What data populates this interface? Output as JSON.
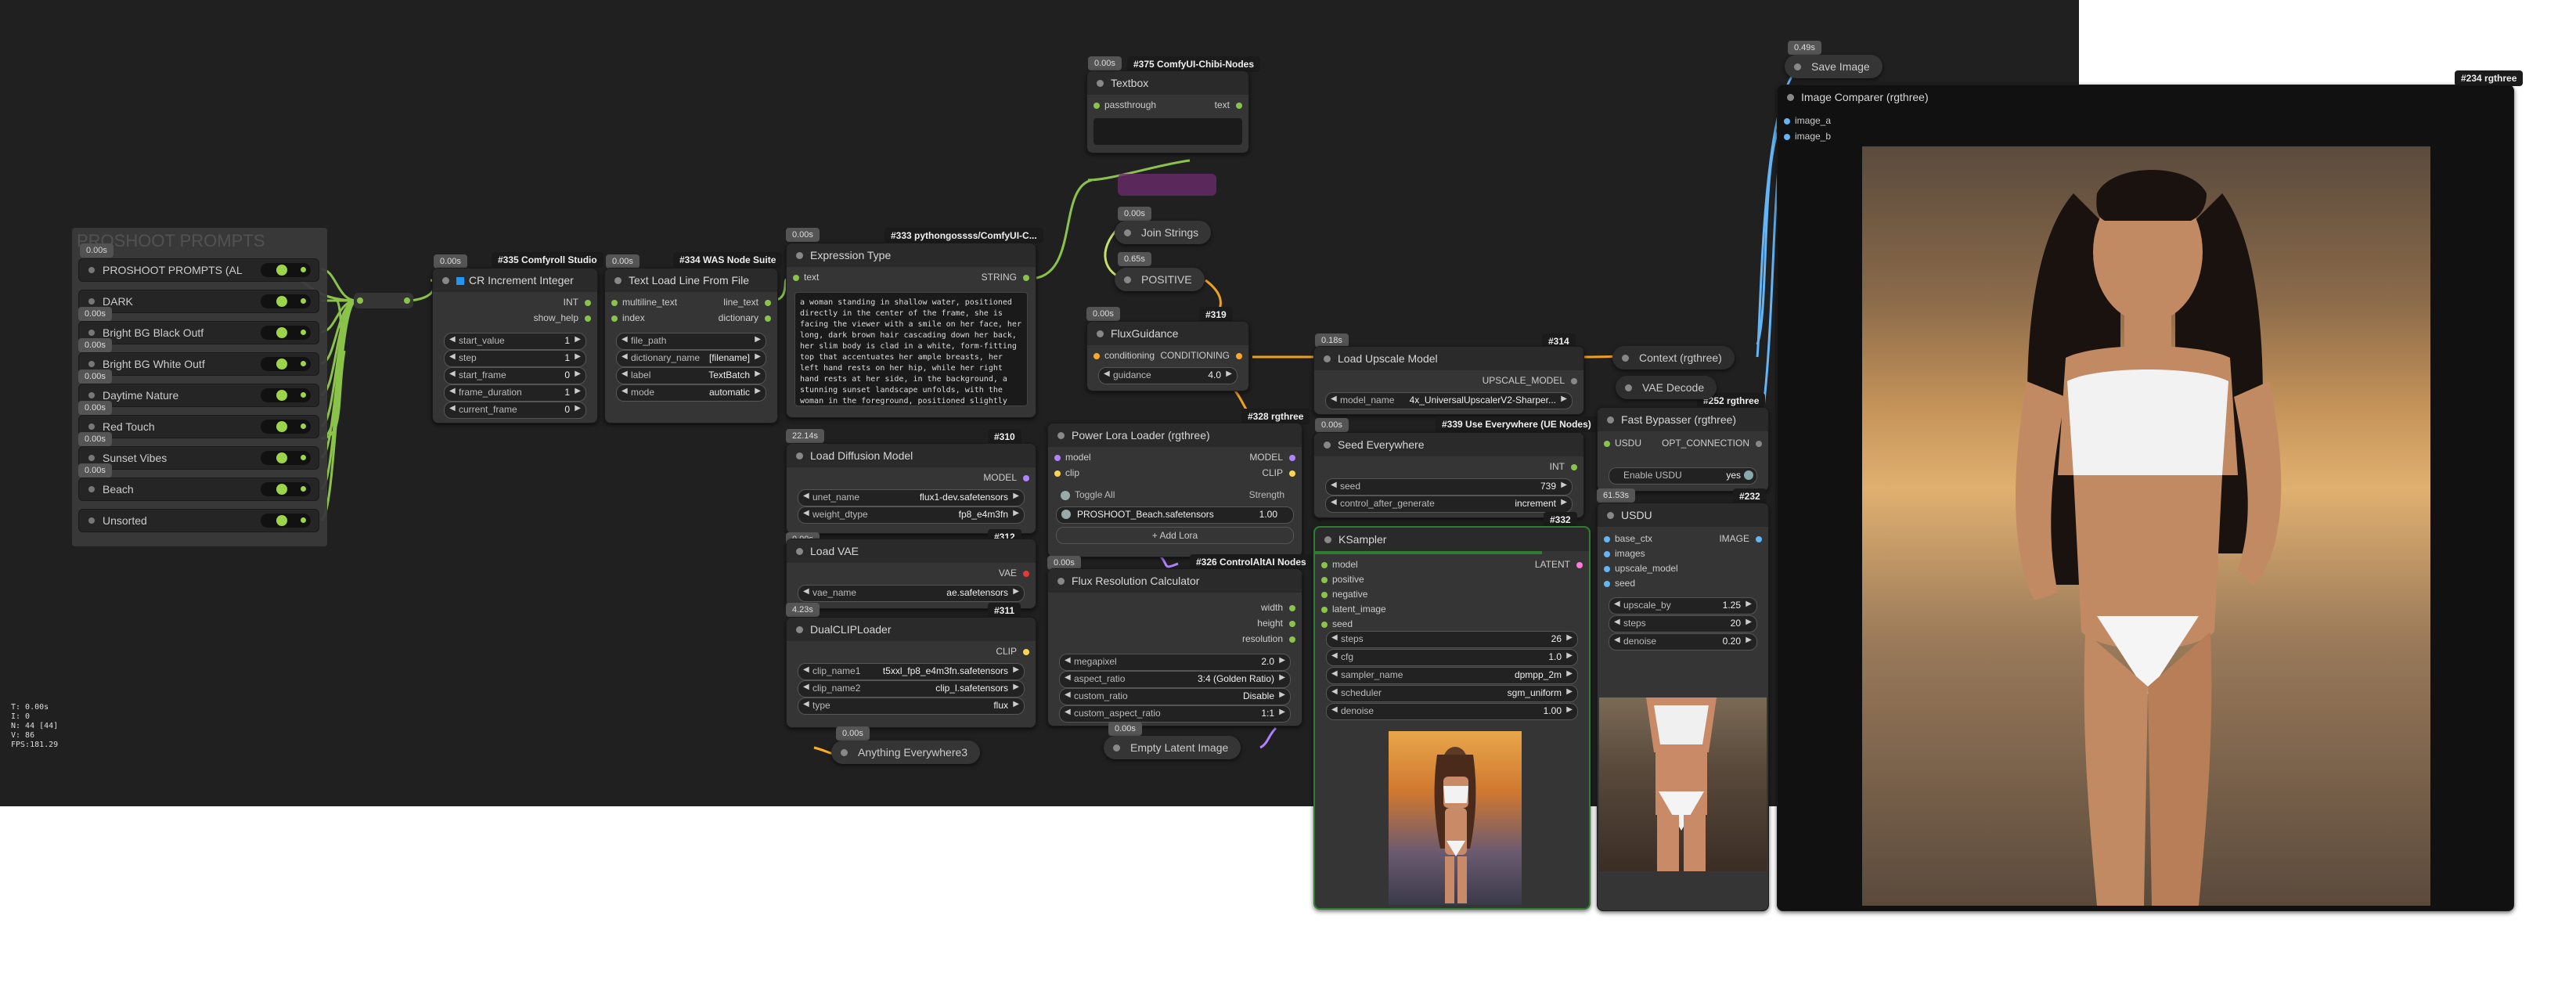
{
  "canvas_info": [
    "T: 0.00s",
    "I: 0",
    "N: 44 [44]",
    "V: 86",
    "FPS:181.29"
  ],
  "group": {
    "title": "PROSHOOT PROMPTS",
    "badge_timing": "0.00s",
    "toggles": [
      {
        "label": "PROSHOOT PROMPTS (AL"
      },
      {
        "label": "DARK"
      },
      {
        "label": "Bright BG Black Outf"
      },
      {
        "label": "Bright BG White Outf"
      },
      {
        "label": "Daytime Nature"
      },
      {
        "label": "Red Touch"
      },
      {
        "label": "Sunset Vibes"
      },
      {
        "label": "Beach"
      },
      {
        "label": "Unsorted"
      }
    ],
    "small_badges": [
      "0.00s",
      "0.00s",
      "0.00s",
      "0.00s",
      "0.00s",
      "0.00s"
    ]
  },
  "nodes": {
    "cr_increment": {
      "timing": "0.00s",
      "id": "#335 Comfyroll Studio",
      "title": "CR Increment Integer",
      "outputs": [
        "INT",
        "show_help"
      ],
      "widgets": [
        {
          "label": "start_value",
          "value": "1"
        },
        {
          "label": "step",
          "value": "1"
        },
        {
          "label": "start_frame",
          "value": "0"
        },
        {
          "label": "frame_duration",
          "value": "1"
        },
        {
          "label": "current_frame",
          "value": "0"
        }
      ]
    },
    "text_load": {
      "timing": "0.00s",
      "id": "#334 WAS Node Suite",
      "title": "Text Load Line From File",
      "inputs": [
        "multiline_text",
        "index"
      ],
      "outputs": [
        "line_text",
        "dictionary"
      ],
      "widgets": [
        {
          "label": "file_path",
          "value": ""
        },
        {
          "label": "dictionary_name",
          "value": "[filename]"
        },
        {
          "label": "label",
          "value": "TextBatch"
        },
        {
          "label": "mode",
          "value": "automatic"
        }
      ]
    },
    "expression_type": {
      "timing": "0.00s",
      "id": "#333 pythongossss/ComfyUI-C...",
      "title": "Expression Type",
      "input": "text",
      "output": "STRING",
      "text": "a woman standing in shallow water, positioned directly in the center of the frame, she is facing the viewer with a smile on her face, her long, dark brown hair cascading down her back, her slim body is clad in a white, form-fitting top that accentuates her ample breasts, her left hand rests on her hip, while her right hand rests at her side, in the background, a stunning sunset landscape unfolds, with the woman in the foreground, positioned slightly off-center to the right, the overall effect is one of serenity and tranquility"
    },
    "load_diffusion": {
      "timing": "22.14s",
      "id": "#310",
      "title": "Load Diffusion Model",
      "output": "MODEL",
      "widgets": [
        {
          "label": "unet_name",
          "value": "flux1-dev.safetensors"
        },
        {
          "label": "weight_dtype",
          "value": "fp8_e4m3fn"
        }
      ]
    },
    "load_vae": {
      "timing": "0.00s",
      "id": "#312",
      "title": "Load VAE",
      "output": "VAE",
      "widgets": [
        {
          "label": "vae_name",
          "value": "ae.safetensors"
        }
      ]
    },
    "dual_clip": {
      "timing": "4.23s",
      "id": "#311",
      "title": "DualCLIPLoader",
      "output": "CLIP",
      "widgets": [
        {
          "label": "clip_name1",
          "value": "t5xxl_fp8_e4m3fn.safetensors"
        },
        {
          "label": "clip_name2",
          "value": "clip_l.safetensors"
        },
        {
          "label": "type",
          "value": "flux"
        }
      ]
    },
    "anything_everywhere": {
      "timing": "0.00s",
      "title": "Anything Everywhere3"
    },
    "textbox": {
      "timing": "0.00s",
      "id": "#375 ComfyUI-Chibi-Nodes",
      "title": "Textbox",
      "input": "passthrough",
      "output": "text"
    },
    "join_strings": {
      "timing": "0.00s",
      "title": "Join Strings"
    },
    "positive": {
      "timing": "0.65s",
      "title": "POSITIVE"
    },
    "flux_guidance": {
      "timing": "0.00s",
      "id": "#319",
      "title": "FluxGuidance",
      "input": "conditioning",
      "output": "CONDITIONING",
      "widgets": [
        {
          "label": "guidance",
          "value": "4.0"
        }
      ]
    },
    "power_lora": {
      "id": "#328 rgthree",
      "title": "Power Lora Loader (rgthree)",
      "inputs": [
        "model",
        "clip"
      ],
      "outputs": [
        "MODEL",
        "CLIP"
      ],
      "toggle_all": "Toggle All",
      "strength_label": "Strength",
      "loras": [
        {
          "name": "PROSHOOT_Beach.safetensors",
          "strength": "1.00"
        }
      ],
      "add_lora": "+ Add Lora"
    },
    "flux_resolution": {
      "timing": "0.00s",
      "id": "#326 ControlAltAI Nodes",
      "title": "Flux Resolution Calculator",
      "outputs": [
        "width",
        "height",
        "resolution"
      ],
      "widgets": [
        {
          "label": "megapixel",
          "value": "2.0"
        },
        {
          "label": "aspect_ratio",
          "value": "3:4 (Golden Ratio)"
        },
        {
          "label": "custom_ratio",
          "value": "Disable"
        },
        {
          "label": "custom_aspect_ratio",
          "value": "1:1"
        }
      ]
    },
    "empty_latent": {
      "timing": "0.00s",
      "title": "Empty Latent Image"
    },
    "load_upscale": {
      "timing": "0.18s",
      "id": "#314",
      "title": "Load Upscale Model",
      "output": "UPSCALE_MODEL",
      "widgets": [
        {
          "label": "model_name",
          "value": "4x_UniversalUpscalerV2-Sharper..."
        }
      ]
    },
    "seed_everywhere": {
      "timing": "0.00s",
      "id": "#339 Use Everywhere (UE Nodes)",
      "title": "Seed Everywhere",
      "output": "INT",
      "widgets": [
        {
          "label": "seed",
          "value": "739"
        },
        {
          "label": "control_after_generate",
          "value": "increment"
        }
      ]
    },
    "ksampler": {
      "id": "#332",
      "title": "KSampler",
      "inputs": [
        "model",
        "positive",
        "negative",
        "latent_image",
        "seed"
      ],
      "output": "LATENT",
      "widgets": [
        {
          "label": "steps",
          "value": "26"
        },
        {
          "label": "cfg",
          "value": "1.0"
        },
        {
          "label": "sampler_name",
          "value": "dpmpp_2m"
        },
        {
          "label": "scheduler",
          "value": "sgm_uniform"
        },
        {
          "label": "denoise",
          "value": "1.00"
        }
      ]
    },
    "context": {
      "title": "Context (rgthree)"
    },
    "vae_decode": {
      "title": "VAE Decode",
      "id": "#252 rgthree"
    },
    "fast_bypasser": {
      "title": "Fast Bypasser (rgthree)",
      "input": "USDU",
      "output": "OPT_CONNECTION",
      "toggle_label": "Enable USDU",
      "toggle_value": "yes"
    },
    "usdu": {
      "timing": "61.53s",
      "id": "#232",
      "title": "USDU",
      "inputs": [
        "base_ctx",
        "images",
        "upscale_model",
        "seed"
      ],
      "output": "IMAGE",
      "widgets": [
        {
          "label": "upscale_by",
          "value": "1.25"
        },
        {
          "label": "steps",
          "value": "20"
        },
        {
          "label": "denoise",
          "value": "0.20"
        }
      ]
    },
    "save_image": {
      "timing": "0.49s",
      "title": "Save Image"
    },
    "image_comparer": {
      "id": "#234 rgthree",
      "title": "Image Comparer (rgthree)",
      "inputs": [
        "image_a",
        "image_b"
      ]
    }
  }
}
